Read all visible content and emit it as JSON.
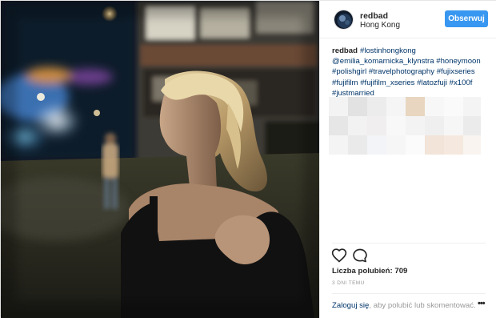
{
  "header": {
    "username": "redbad",
    "location": "Hong Kong",
    "follow_label": "Obserwuj"
  },
  "caption": {
    "author": "redbad",
    "tags": [
      "#lostinhongkong",
      "@emilia_komarnicka_klynstra",
      "#honeymoon",
      "#polishgirl",
      "#travelphotography",
      "#fujixseries",
      "#fujifilm",
      "#fujifilm_xseries",
      "#latozfuji",
      "#x100f",
      "#justmarried"
    ]
  },
  "likes": {
    "label": "Liczba polubień:",
    "count": "709"
  },
  "time_ago": "3 DNI TEMU",
  "login": {
    "link": "Zaloguj się",
    "text": ", aby polubić lub skomentować."
  },
  "icons": {
    "like": "heart-icon",
    "comment": "comment-bubble-icon",
    "more": "more-options-icon"
  },
  "colors": {
    "follow_button": "#3897f0",
    "hashtag": "#003569"
  }
}
